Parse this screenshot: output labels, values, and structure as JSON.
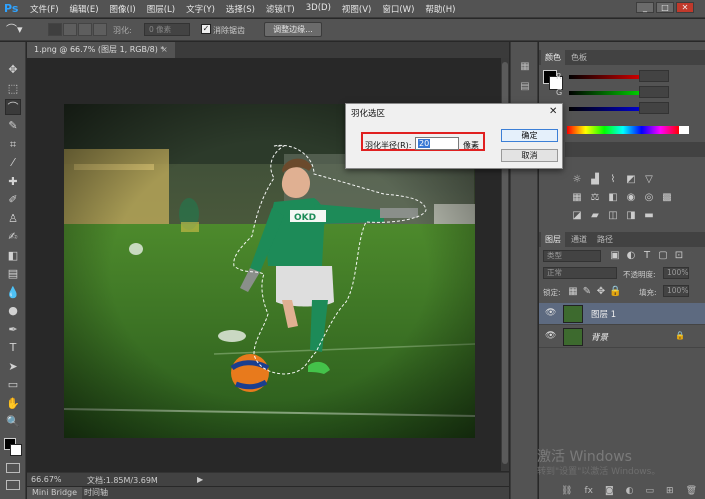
{
  "app": {
    "logo": "Ps",
    "menu": [
      "文件(F)",
      "编辑(E)",
      "图像(I)",
      "图层(L)",
      "文字(Y)",
      "选择(S)",
      "滤镜(T)",
      "3D(D)",
      "视图(V)",
      "窗口(W)",
      "帮助(H)"
    ],
    "window_buttons": [
      "_",
      "□",
      "✕"
    ]
  },
  "options_bar": {
    "feather_label": "羽化:",
    "feather_value": "0 像素",
    "antialias_checked": true,
    "antialias_label": "消除锯齿",
    "refine_edge_label": "调整边缘..."
  },
  "document": {
    "tab_title": "1.png @ 66.7% (图层 1, RGB/8) *",
    "tab_close": "×",
    "zoom": "66.67%",
    "doc_size": "文档:1.85M/3.69M",
    "bottom_tabs": [
      "Mini Bridge",
      "时间轴"
    ]
  },
  "dialog": {
    "title": "羽化选区",
    "close": "✕",
    "radius_label": "羽化半径(R):",
    "radius_value": "20",
    "radius_unit": "像素",
    "ok_label": "确定",
    "cancel_label": "取消"
  },
  "panels": {
    "color_tabs": [
      "颜色",
      "色板"
    ],
    "channels": [
      "R",
      "G",
      "B"
    ],
    "style_tabs": [
      "样式"
    ],
    "adjust_label": "调整",
    "layer_tabs": [
      "图层",
      "通道",
      "路径"
    ],
    "kind_label": "类型",
    "blend_mode": "正常",
    "opacity_label": "不透明度:",
    "opacity_value": "100%",
    "lock_label": "锁定:",
    "fill_label": "填充:",
    "fill_value": "100%",
    "layers": [
      {
        "name": "图层 1",
        "selected": true
      },
      {
        "name": "背景",
        "selected": false,
        "locked": true
      }
    ]
  },
  "watermark": {
    "line1": "激活 Windows",
    "line2": "转到\"设置\"以激活 Windows。"
  },
  "colors": {
    "accent_selection": "#3778d4",
    "dialog_highlight": "#e02020",
    "layer_selected": "#5d6a80"
  }
}
